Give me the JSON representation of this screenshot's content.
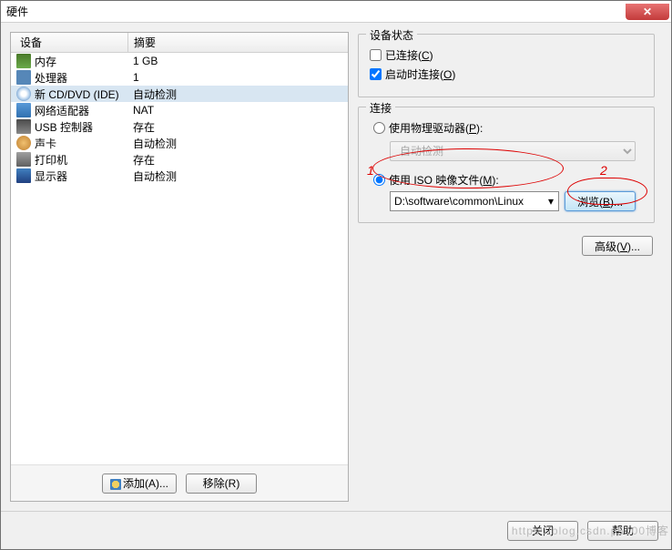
{
  "titlebar": {
    "title": "硬件"
  },
  "table": {
    "header": {
      "device": "设备",
      "summary": "摘要"
    },
    "rows": [
      {
        "name": "内存",
        "summary": "1 GB"
      },
      {
        "name": "处理器",
        "summary": "1"
      },
      {
        "name": "新 CD/DVD (IDE)",
        "summary": "自动检测",
        "selected": true
      },
      {
        "name": "网络适配器",
        "summary": "NAT"
      },
      {
        "name": "USB 控制器",
        "summary": "存在"
      },
      {
        "name": "声卡",
        "summary": "自动检测"
      },
      {
        "name": "打印机",
        "summary": "存在"
      },
      {
        "name": "显示器",
        "summary": "自动检测"
      }
    ]
  },
  "left_buttons": {
    "add": "添加(A)...",
    "remove": "移除(R)"
  },
  "status": {
    "legend": "设备状态",
    "connected_label": "已连接(C)",
    "connect_at_poweron_label": "启动时连接(O)",
    "connected": false,
    "connect_at_poweron": true
  },
  "connection": {
    "legend": "连接",
    "radio_physical": "使用物理驱动器(P):",
    "physical_select": "自动检测",
    "radio_iso": "使用 ISO 映像文件(M):",
    "iso_path": "D:\\software\\common\\Linux",
    "browse": "浏览(B)...",
    "advanced": "高级(V)..."
  },
  "annotations": {
    "one": "1",
    "two": "2"
  },
  "footer": {
    "close": "关闭",
    "help": "帮助"
  },
  "watermark": "https://blog.csdn.p5100博客"
}
